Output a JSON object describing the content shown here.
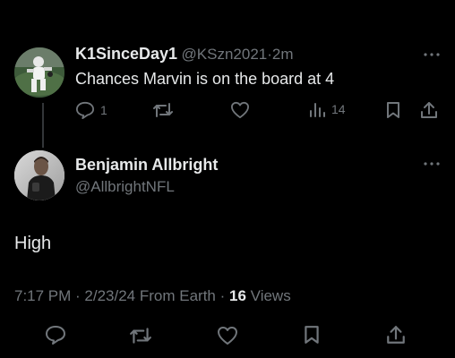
{
  "reply_tweet": {
    "display_name": "K1SinceDay1",
    "handle": "@KSzn2021",
    "separator": "·",
    "time": "2m",
    "text": "Chances Marvin is on the board at 4",
    "actions": {
      "reply_count": "1",
      "retweet_count": "",
      "like_count": "",
      "views_count": "14"
    },
    "icons": [
      "more-icon",
      "reply-icon",
      "retweet-icon",
      "like-icon",
      "views-icon",
      "bookmark-icon",
      "share-icon"
    ]
  },
  "main_tweet": {
    "display_name": "Benjamin Allbright",
    "handle": "@AllbrightNFL",
    "text": "High",
    "timestamp": "7:17 PM · 2/23/24 From Earth ·",
    "views_count": "16",
    "views_label": "Views",
    "icons": [
      "more-icon",
      "reply-icon",
      "retweet-icon",
      "like-icon",
      "bookmark-icon",
      "share-icon"
    ]
  },
  "colors": {
    "background": "#000000",
    "primary_text": "#e7e9ea",
    "secondary_text": "#71767b"
  }
}
